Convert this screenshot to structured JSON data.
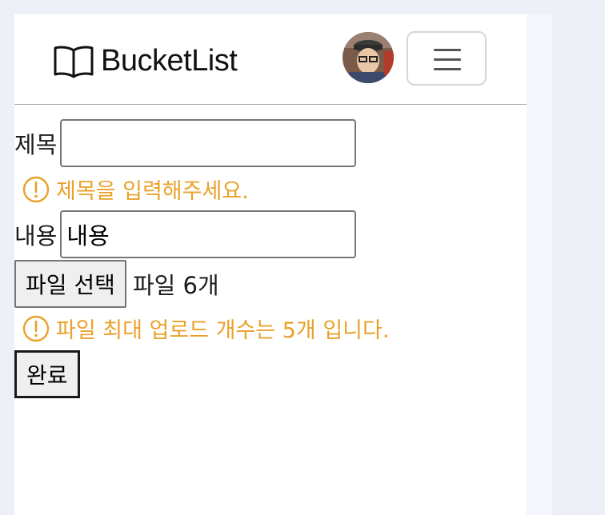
{
  "navbar": {
    "brand": "BucketList",
    "brand_icon": "book-icon",
    "avatar_icon": "user-avatar",
    "menu_icon": "hamburger-icon"
  },
  "form": {
    "title_label": "제목",
    "title_value": "",
    "title_error": "제목을 입력해주세요.",
    "content_label": "내용",
    "content_value": "내용",
    "file_button": "파일 선택",
    "file_status": "파일 6개",
    "file_error": "파일 최대 업로드 개수는 5개 입니다.",
    "submit": "완료",
    "error_icon": "exclamation-circle-icon"
  },
  "colors": {
    "error": "#e9a12a",
    "page_background": "#eef0f8"
  }
}
